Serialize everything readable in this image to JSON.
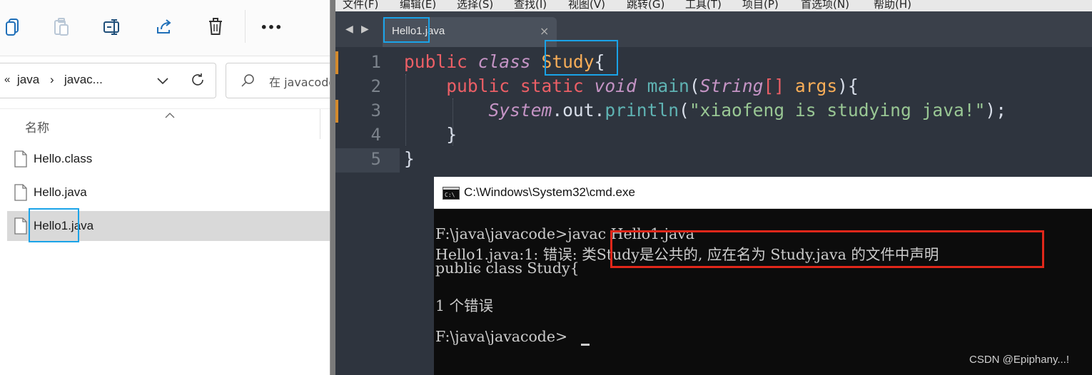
{
  "explorer": {
    "toolbar_icons": [
      "copy-icon",
      "paste-icon",
      "rename-icon",
      "share-icon",
      "delete-icon",
      "more-icon"
    ],
    "more_label": "•••",
    "address": {
      "prefix": "«",
      "segments": [
        "java",
        "javac..."
      ],
      "separator": "›"
    },
    "search_placeholder": "在 javacode",
    "column_name": "名称",
    "files": [
      "Hello.class",
      "Hello.java",
      "Hello1.java"
    ],
    "selected_file": "Hello1.java"
  },
  "editor": {
    "menu": [
      "文件(F)",
      "编辑(E)",
      "选择(S)",
      "查找(I)",
      "视图(V)",
      "跳转(G)",
      "工具(T)",
      "项目(P)",
      "首选项(N)",
      "帮助(H)"
    ],
    "tab_label": "Hello1.java",
    "tab_close": "×",
    "line_numbers": [
      "1",
      "2",
      "3",
      "4",
      "5"
    ],
    "code": {
      "l1_public": "public",
      "l1_class": "class",
      "l1_name": "Study",
      "l1_brace": "{",
      "l2_public": "public",
      "l2_static": "static",
      "l2_void": "void",
      "l2_main": "main",
      "l2_paren": "(",
      "l2_string": "String",
      "l2_brackets": "[]",
      "l2_args": "args",
      "l2_end": "){",
      "l3_system": "System",
      "l3_dot_out": ".out.",
      "l3_println": "println",
      "l3_paren": "(",
      "l3_str": "\"xiaofeng is studying java!\"",
      "l3_end": ");",
      "l4": "}",
      "l5": "}"
    }
  },
  "cmd": {
    "title": "C:\\Windows\\System32\\cmd.exe",
    "lines": [
      "F:\\java\\javacode>javac Hello1.java",
      "Hello1.java:1: 错误: 类Study是公共的, 应在名为 Study.java 的文件中声明",
      "public class Study{",
      "            ^",
      "1 个错误",
      "F:\\java\\javacode>"
    ]
  },
  "watermark": "CSDN @Epiphany...!",
  "colors": {
    "highlight_blue": "#1aa3e8",
    "highlight_red": "#e0271a",
    "editor_bg": "#2e343e"
  }
}
